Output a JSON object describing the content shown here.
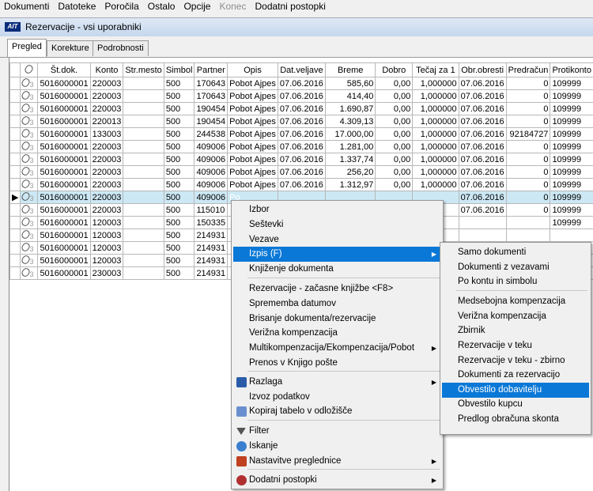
{
  "menubar": [
    "Dokumenti",
    "Datoteke",
    "Poročila",
    "Ostalo",
    "Opcije",
    "Konec",
    "Dodatni postopki"
  ],
  "window": {
    "logo": "AIT",
    "title": "Rezervacije - vsi uporabniki"
  },
  "tabs": [
    "Pregled",
    "Korekture",
    "Podrobnosti"
  ],
  "table": {
    "headers": [
      "",
      "Št.dok.",
      "Konto",
      "Str.mesto",
      "Simbol",
      "Partner",
      "Opis",
      "Dat.veljave",
      "Breme",
      "Dobro",
      "Tečaj za 1",
      "Obr.obresti",
      "Predračun",
      "Protikonto"
    ],
    "rows": [
      [
        "3",
        "5016000001",
        "220003",
        "",
        "500",
        "170643",
        "Pobot Ajpes",
        "07.06.2016",
        "585,60",
        "0,00",
        "1,000000",
        "07.06.2016",
        "0",
        "109999"
      ],
      [
        "3",
        "5016000001",
        "220003",
        "",
        "500",
        "170643",
        "Pobot Ajpes",
        "07.06.2016",
        "414,40",
        "0,00",
        "1,000000",
        "07.06.2016",
        "0",
        "109999"
      ],
      [
        "3",
        "5016000001",
        "220003",
        "",
        "500",
        "190454",
        "Pobot Ajpes",
        "07.06.2016",
        "1.690,87",
        "0,00",
        "1,000000",
        "07.06.2016",
        "0",
        "109999"
      ],
      [
        "3",
        "5016000001",
        "220013",
        "",
        "500",
        "190454",
        "Pobot Ajpes",
        "07.06.2016",
        "4.309,13",
        "0,00",
        "1,000000",
        "07.06.2016",
        "0",
        "109999"
      ],
      [
        "3",
        "5016000001",
        "133003",
        "",
        "500",
        "244538",
        "Pobot Ajpes",
        "07.06.2016",
        "17.000,00",
        "0,00",
        "1,000000",
        "07.06.2016",
        "92184727",
        "109999"
      ],
      [
        "3",
        "5016000001",
        "220003",
        "",
        "500",
        "409006",
        "Pobot Ajpes",
        "07.06.2016",
        "1.281,00",
        "0,00",
        "1,000000",
        "07.06.2016",
        "0",
        "109999"
      ],
      [
        "3",
        "5016000001",
        "220003",
        "",
        "500",
        "409006",
        "Pobot Ajpes",
        "07.06.2016",
        "1.337,74",
        "0,00",
        "1,000000",
        "07.06.2016",
        "0",
        "109999"
      ],
      [
        "3",
        "5016000001",
        "220003",
        "",
        "500",
        "409006",
        "Pobot Ajpes",
        "07.06.2016",
        "256,20",
        "0,00",
        "1,000000",
        "07.06.2016",
        "0",
        "109999"
      ],
      [
        "3",
        "5016000001",
        "220003",
        "",
        "500",
        "409006",
        "Pobot Ajpes",
        "07.06.2016",
        "1.312,97",
        "0,00",
        "1,000000",
        "07.06.2016",
        "0",
        "109999"
      ],
      [
        "3",
        "5016000001",
        "220003",
        "",
        "500",
        "409006",
        "Po",
        "",
        "",
        "",
        "",
        "07.06.2016",
        "0",
        "109999"
      ],
      [
        "3",
        "5016000001",
        "220003",
        "",
        "500",
        "115010",
        "",
        "",
        "",
        "",
        "",
        "07.06.2016",
        "0",
        "109999"
      ],
      [
        "3",
        "5016000001",
        "120003",
        "",
        "500",
        "150335",
        "",
        "",
        "",
        "",
        "",
        "",
        "",
        "109999"
      ],
      [
        "3",
        "5016000001",
        "120003",
        "",
        "500",
        "214931",
        "",
        "",
        "",
        "",
        "",
        "",
        "",
        ""
      ],
      [
        "3",
        "5016000001",
        "120003",
        "",
        "500",
        "214931",
        "",
        "",
        "",
        "",
        "",
        "",
        "",
        ""
      ],
      [
        "3",
        "5016000001",
        "120003",
        "",
        "500",
        "214931",
        "",
        "",
        "",
        "",
        "",
        "",
        "",
        ""
      ],
      [
        "3",
        "5016000001",
        "230003",
        "",
        "500",
        "214931",
        "",
        "",
        "",
        "",
        "",
        "",
        "",
        ""
      ]
    ]
  },
  "context_menu": {
    "items": [
      "Izbor",
      "Seštevki",
      "Vezave",
      "Izpis (F)",
      "Knjiženje dokumenta",
      "Rezervacije - začasne knjižbe <F8>",
      "Sprememba datumov",
      "Brisanje dokumenta/rezervacije",
      "Verižna kompenzacija",
      "Multikompenzacija/Ekompenzacija/Pobot",
      "Prenos v Knjigo pošte",
      "Razlaga",
      "Izvoz podatkov",
      "Kopiraj tabelo v odložišče",
      "Filter",
      "Iskanje",
      "Nastavitve preglednice",
      "Dodatni postopki"
    ]
  },
  "submenu": {
    "items": [
      "Samo dokumenti",
      "Dokumenti z vezavami",
      "Po kontu in simbolu",
      "Medsebojna kompenzacija",
      "Verižna kompenzacija",
      "Zbirnik",
      "Rezervacije v teku",
      "Rezervacije v teku - zbirno",
      "Dokumenti za rezervacijo",
      "Obvestilo dobavitelju",
      "Obvestilo kupcu",
      "Predlog obračuna skonta"
    ]
  },
  "colors": {
    "highlight": "#0a78d7",
    "selected_row": "#cce8f4",
    "title_bar": "#c5d7ee"
  }
}
